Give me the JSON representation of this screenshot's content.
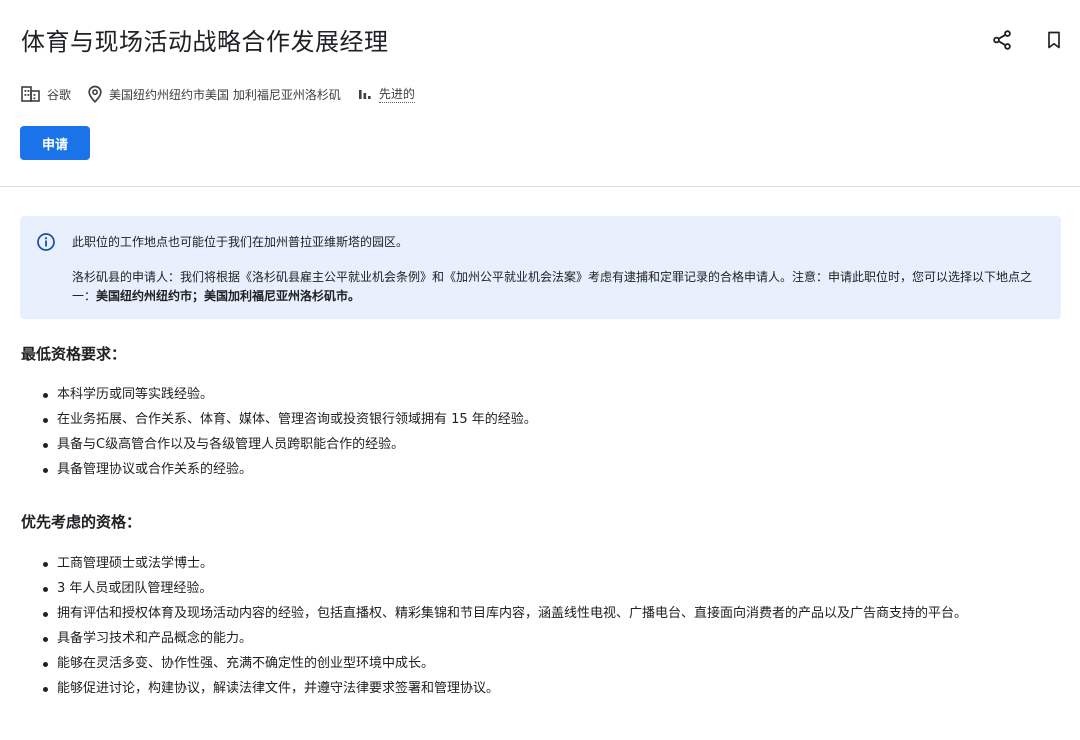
{
  "header": {
    "title": "体育与现场活动战略合作发展经理",
    "share_icon": "share-icon",
    "bookmark_icon": "bookmark-icon"
  },
  "meta": {
    "company": "谷歌",
    "location": "美国纽约州纽约市美国 加利福尼亚州洛杉矶",
    "level": "先进的"
  },
  "apply_label": "申请",
  "notice": {
    "line1": "此职位的工作地点也可能位于我们在加州普拉亚维斯塔的园区。",
    "line2_prefix": "洛杉矶县的申请人：我们将根据《洛杉矶县雇主公平就业机会条例》和《加州公平就业机会法案》考虑有逮捕和定罪记录的合格申请人。注意：申请此职位时，您可以选择以下地点之一：",
    "line2_bold": "美国纽约州纽约市；美国加利福尼亚州洛杉矶市。"
  },
  "minimum": {
    "title": "最低资格要求：",
    "items": [
      "本科学历或同等实践经验。",
      "在业务拓展、合作关系、体育、媒体、管理咨询或投资银行领域拥有 15 年的经验。",
      "具备与C级高管合作以及与各级管理人员跨职能合作的经验。",
      "具备管理协议或合作关系的经验。"
    ]
  },
  "preferred": {
    "title": "优先考虑的资格：",
    "items": [
      "工商管理硕士或法学博士。",
      "3 年人员或团队管理经验。",
      "拥有评估和授权体育及现场活动内容的经验，包括直播权、精彩集锦和节目库内容，涵盖线性电视、广播电台、直接面向消费者的产品以及广告商支持的平台。",
      "具备学习技术和产品概念的能力。",
      "能够在灵活多变、协作性强、充满不确定性的创业型环境中成长。",
      "能够促进讨论，构建协议，解读法律文件，并遵守法律要求签署和管理协议。"
    ]
  }
}
